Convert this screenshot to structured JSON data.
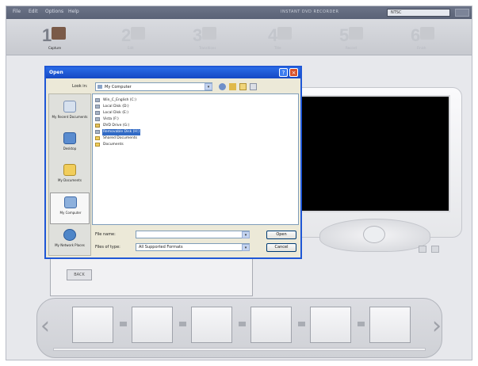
{
  "menubar": {
    "items": [
      "File",
      "Edit",
      "Options",
      "Help"
    ],
    "status_text": "INSTANT DVD RECORDER",
    "mode_value": "NTSC"
  },
  "toolbar": {
    "steps": [
      {
        "num": "1",
        "label": "Capture",
        "icon": "capture-icon",
        "active": true
      },
      {
        "num": "2",
        "label": "Edit",
        "icon": "edit-icon",
        "active": false
      },
      {
        "num": "3",
        "label": "Transitions",
        "icon": "transitions-icon",
        "active": false
      },
      {
        "num": "4",
        "label": "Title",
        "icon": "title-icon",
        "active": false
      },
      {
        "num": "5",
        "label": "Record",
        "icon": "record-icon",
        "active": false
      },
      {
        "num": "6",
        "label": "Finish",
        "icon": "finish-icon",
        "active": false
      }
    ]
  },
  "back_button_label": "BACK",
  "dialog": {
    "title": "Open",
    "help_glyph": "?",
    "close_glyph": "×",
    "look_in_label": "Look in:",
    "look_in_value": "My Computer",
    "places": [
      {
        "label": "My Recent Documents",
        "icon": "recent-documents-icon"
      },
      {
        "label": "Desktop",
        "icon": "desktop-icon"
      },
      {
        "label": "My Documents",
        "icon": "my-documents-icon"
      },
      {
        "label": "My Computer",
        "icon": "my-computer-icon"
      },
      {
        "label": "My Network Places",
        "icon": "network-places-icon"
      }
    ],
    "files": [
      {
        "name": "Win_C_English (C:)",
        "icon": "drive-icon",
        "selected": false
      },
      {
        "name": "Local Disk (D:)",
        "icon": "drive-icon",
        "selected": false
      },
      {
        "name": "Local Disk (E:)",
        "icon": "drive-icon",
        "selected": false
      },
      {
        "name": "Vista (F:)",
        "icon": "drive-icon",
        "selected": false
      },
      {
        "name": "DVD Drive (G:)",
        "icon": "dvd-drive-icon",
        "selected": false
      },
      {
        "name": "Removable Disk (H:)",
        "icon": "removable-disk-icon",
        "selected": true
      },
      {
        "name": "Shared Documents",
        "icon": "folder-icon",
        "selected": false
      },
      {
        "name": "Documents",
        "icon": "folder-icon",
        "selected": false
      }
    ],
    "file_name_label": "File name:",
    "file_name_value": "",
    "files_of_type_label": "Files of type:",
    "files_of_type_value": "All Supported Formats",
    "open_label": "Open",
    "cancel_label": "Cancel"
  },
  "colors": {
    "accent": "#1f57d6",
    "selection": "#316ac5",
    "screen": "#000000"
  }
}
